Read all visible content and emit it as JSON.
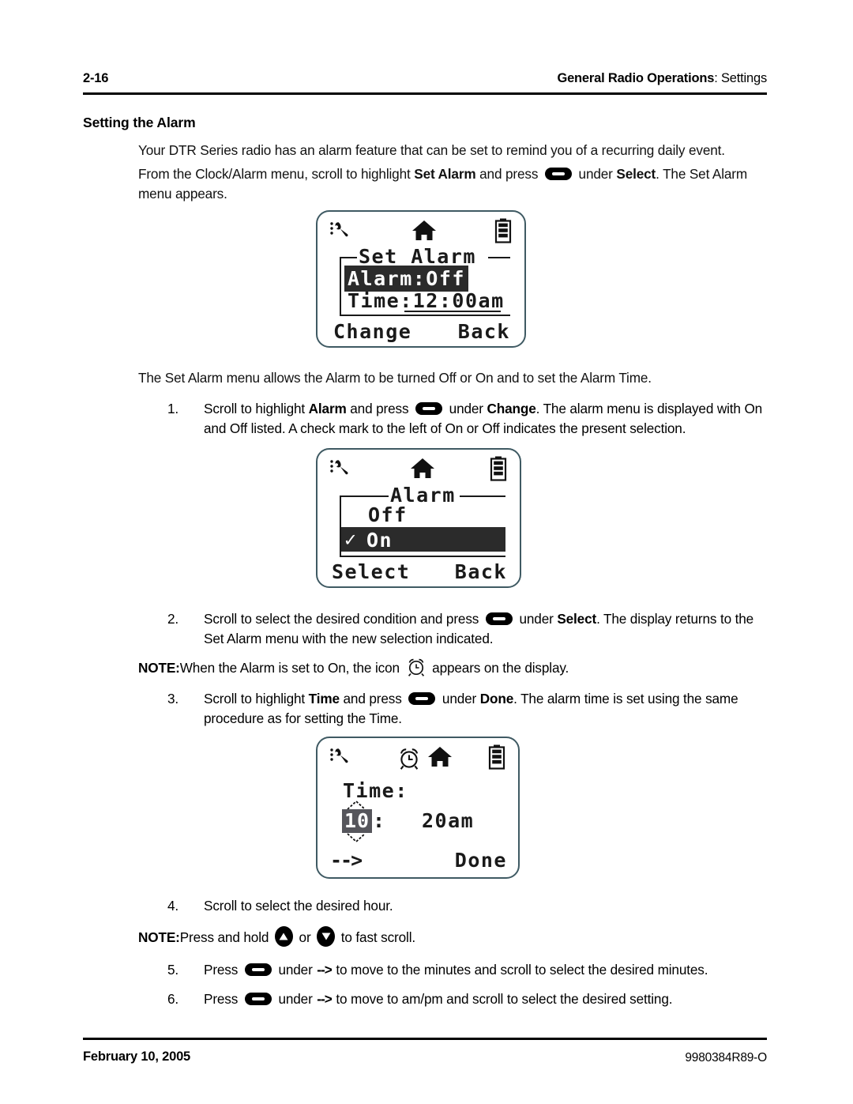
{
  "header": {
    "page_number": "2-16",
    "section_bold": "General Radio Operations",
    "section_rest": ": Settings"
  },
  "section_title": "Setting the Alarm",
  "paragraphs": {
    "intro": "Your DTR Series radio has an alarm feature that can be set to remind you of a recurring daily event.",
    "from_clock_p1": "From the Clock/Alarm menu, scroll to highlight ",
    "from_clock_b1": "Set Alarm",
    "from_clock_p2": " and press ",
    "from_clock_p3": " under ",
    "from_clock_b2": "Select",
    "from_clock_p4": ". The Set Alarm menu appears.",
    "menu_allows": "The Set Alarm menu allows the Alarm to be turned Off or On and to set the Alarm Time."
  },
  "steps": [
    {
      "num": "1.",
      "t1": "Scroll to highlight ",
      "b1": "Alarm",
      "t2": " and press ",
      "t3": " under ",
      "b2": "Change",
      "t4": ". The alarm menu is displayed with On and Off listed. A check mark to the left of On or Off indicates the present selection."
    },
    {
      "num": "2.",
      "t1": "Scroll to select the desired condition and press ",
      "b1": "",
      "t2": "",
      "t3": " under ",
      "b2": "Select",
      "t4": ". The display returns to the Set Alarm menu with the new selection indicated."
    },
    {
      "num": "3.",
      "t1": "Scroll to highlight ",
      "b1": "Time",
      "t2": " and press ",
      "t3": " under ",
      "b2": "Done",
      "t4": ". The alarm time is set using the same procedure as for setting the Time."
    },
    {
      "num": "4.",
      "t1": "Scroll to select the desired hour.",
      "b1": "",
      "t2": "",
      "t3": "",
      "b2": "",
      "t4": ""
    },
    {
      "num": "5.",
      "t1": "Press ",
      "b1": "",
      "t2": "",
      "t3": " under ",
      "arrow": "-->",
      "t4": " to move to the minutes and scroll to select the desired minutes."
    },
    {
      "num": "6.",
      "t1": "Press ",
      "b1": "",
      "t2": "",
      "t3": " under ",
      "arrow": "-->",
      "t4": " to move to am/pm and scroll to select the desired setting."
    }
  ],
  "notes": {
    "note1_label": "NOTE:",
    "note1_a": "When the Alarm is set to On, the icon ",
    "note1_b": " appears on the display.",
    "note2_label": "NOTE:",
    "note2_a": "Press and hold ",
    "note2_b": " or ",
    "note2_c": " to fast scroll."
  },
  "screens": {
    "screen1": {
      "status_icons": [
        "wrench-icon",
        "home-icon",
        "battery-icon"
      ],
      "title": "Set Alarm",
      "row1": "Alarm:Off",
      "row1_highlighted": true,
      "row2": "Time:12:00am",
      "softkey_left": "Change",
      "softkey_right": "Back"
    },
    "screen2": {
      "status_icons": [
        "wrench-icon",
        "home-icon",
        "battery-icon"
      ],
      "title": "Alarm",
      "row1": "Off",
      "row2_check": "✓",
      "row2": "On",
      "row2_highlighted": true,
      "softkey_left": "Select",
      "softkey_right": "Back"
    },
    "screen3": {
      "status_icons": [
        "wrench-icon",
        "alarm-clock-icon",
        "home-icon",
        "battery-icon"
      ],
      "label": "Time:",
      "hour": "10",
      "hour_highlighted": true,
      "colon": ":",
      "minutes_meridiem": "20am",
      "softkey_left": "-->",
      "softkey_right": "Done"
    }
  },
  "footer": {
    "date": "February 10, 2005",
    "doc_number": "9980384R89-O"
  },
  "colors": {
    "lcd_border": "#3f5a63",
    "lcd_text": "#1a1a1a",
    "highlight_bg": "#2b2b2b",
    "highlight_fg": "#ffffff",
    "page_bg": "#ffffff",
    "ink": "#000000"
  }
}
